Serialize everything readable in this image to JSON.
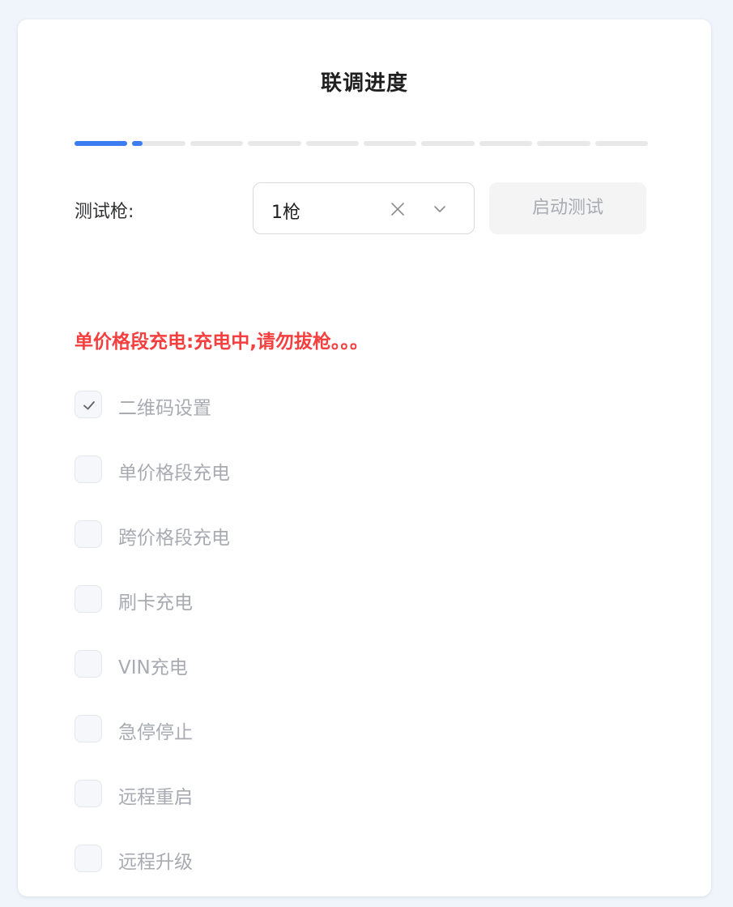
{
  "panel": {
    "title": "联调进度"
  },
  "progress": {
    "total_steps": 10,
    "completed_steps": 1,
    "current_step_progress": 0.2,
    "active_color": "#3b7cf0",
    "inactive_color": "#e8e8e8"
  },
  "test_row": {
    "label": "测试枪:",
    "select_value": "1枪",
    "clear_icon": "close-icon",
    "dropdown_icon": "chevron-down-icon",
    "start_button": "启动测试"
  },
  "status_message": "单价格段充电:充电中,请勿拔枪。。。",
  "status_color": "#f53f3f",
  "checklist": [
    {
      "label": "二维码设置",
      "checked": true
    },
    {
      "label": "单价格段充电",
      "checked": false
    },
    {
      "label": "跨价格段充电",
      "checked": false
    },
    {
      "label": "刷卡充电",
      "checked": false
    },
    {
      "label": "VIN充电",
      "checked": false
    },
    {
      "label": "急停停止",
      "checked": false
    },
    {
      "label": "远程重启",
      "checked": false
    },
    {
      "label": "远程升级",
      "checked": false
    }
  ]
}
